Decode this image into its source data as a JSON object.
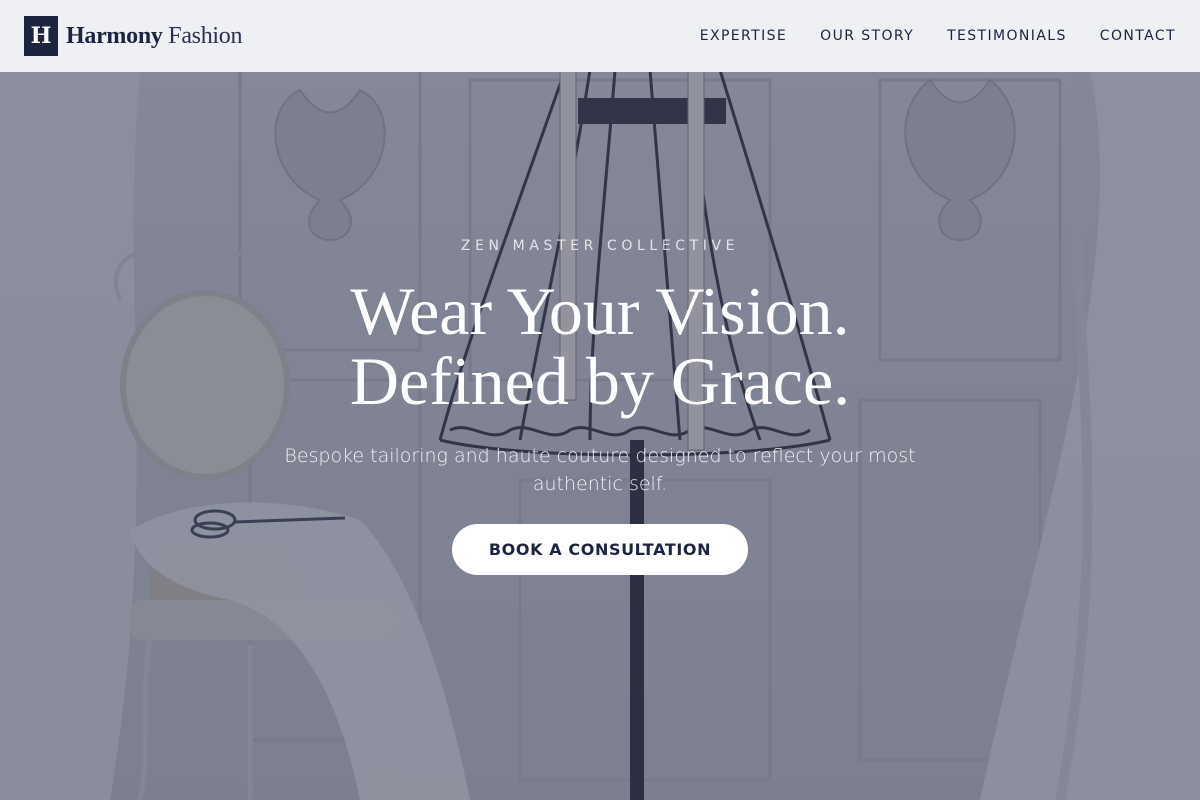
{
  "brand": {
    "mark": "H",
    "name_bold": "Harmony",
    "name_light": "Fashion"
  },
  "nav": {
    "items": [
      {
        "label": "EXPERTISE"
      },
      {
        "label": "OUR STORY"
      },
      {
        "label": "TESTIMONIALS"
      },
      {
        "label": "CONTACT"
      }
    ]
  },
  "hero": {
    "eyebrow": "ZEN MASTER COLLECTIVE",
    "headline_line1": "Wear Your Vision.",
    "headline_line2": "Defined by Grace.",
    "subtitle": "Bespoke tailoring and haute couture designed to reflect your most authentic self.",
    "cta_label": "BOOK A CONSULTATION",
    "background_image": "dress-form-mannequin-with-chair-and-lace-fabric"
  },
  "colors": {
    "brand_navy": "#1c2440",
    "header_bg": "#f4f5f7",
    "overlay": "#3a3e56",
    "cta_bg": "#ffffff"
  }
}
